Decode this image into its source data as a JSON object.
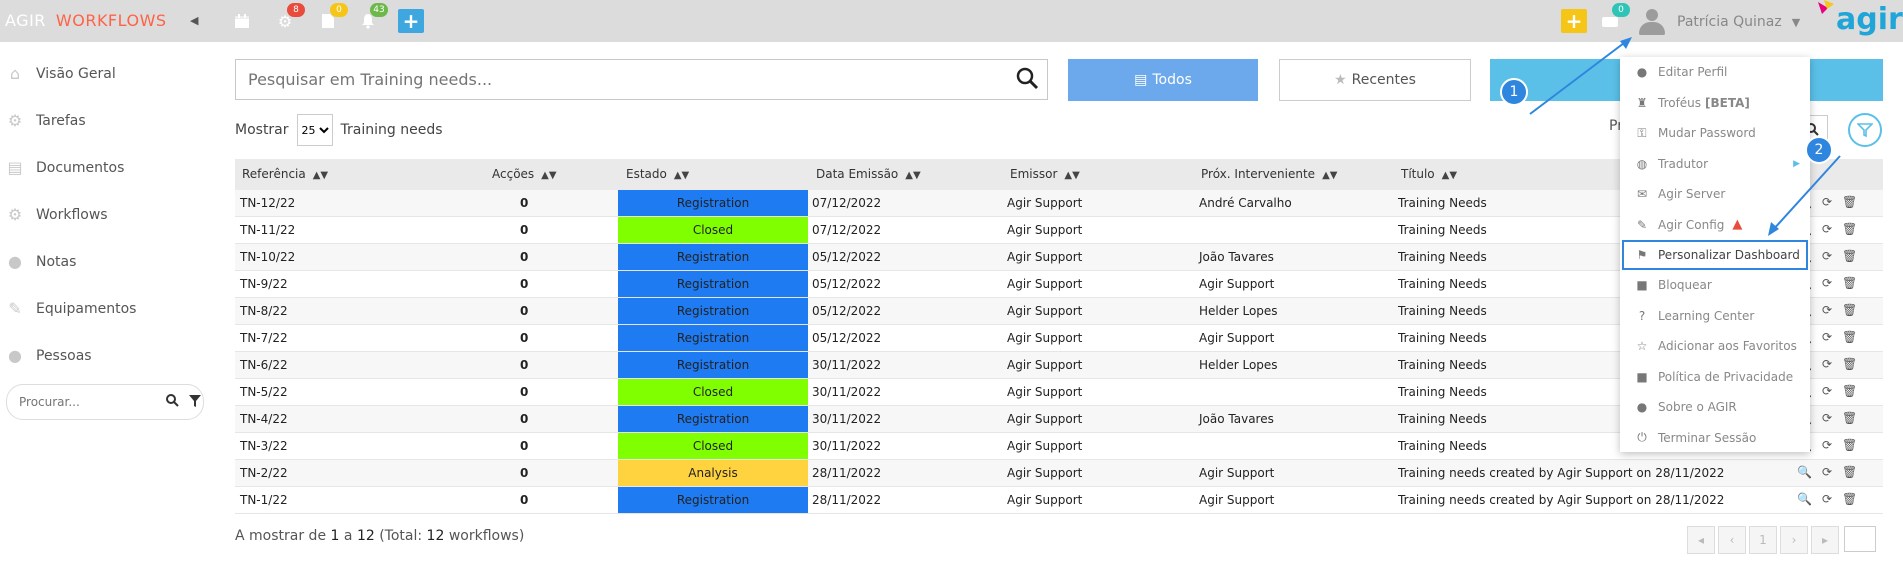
{
  "app": {
    "brand_a": "AGIR",
    "brand_b": "WORKFLOWS"
  },
  "topbar": {
    "badges": {
      "settings": "8",
      "documents": "0",
      "notifications": "43",
      "messages": "0"
    },
    "user_name": "Patrícia Quinaz",
    "logo_text": "agir"
  },
  "sidebar": {
    "items": [
      {
        "label": "Visão Geral",
        "icon": "home-icon"
      },
      {
        "label": "Tarefas",
        "icon": "gear-icon"
      },
      {
        "label": "Documentos",
        "icon": "document-icon"
      },
      {
        "label": "Workflows",
        "icon": "gears-icon"
      },
      {
        "label": "Notas",
        "icon": "chat-icon"
      },
      {
        "label": "Equipamentos",
        "icon": "wrench-icon"
      },
      {
        "label": "Pessoas",
        "icon": "user-icon"
      }
    ],
    "search_placeholder": "Procurar..."
  },
  "search": {
    "placeholder": "Pesquisar em Training needs..."
  },
  "filters": {
    "todos": "Todos",
    "recentes": "Recentes"
  },
  "show": {
    "prefix": "Mostrar",
    "value": "25",
    "suffix": "Training needs",
    "right_label": "Pr"
  },
  "table": {
    "headers": [
      "Referência",
      "Acções",
      "Estado",
      "Data Emissão",
      "Emissor",
      "Próx. Interveniente",
      "Título"
    ],
    "rows": [
      {
        "ref": "TN-12/22",
        "acc": "0",
        "state": "Registration",
        "date": "07/12/2022",
        "emissor": "Agir Support",
        "prox": "André Carvalho",
        "title": "Training Needs"
      },
      {
        "ref": "TN-11/22",
        "acc": "0",
        "state": "Closed",
        "date": "07/12/2022",
        "emissor": "Agir Support",
        "prox": "",
        "title": "Training Needs"
      },
      {
        "ref": "TN-10/22",
        "acc": "0",
        "state": "Registration",
        "date": "05/12/2022",
        "emissor": "Agir Support",
        "prox": "João Tavares",
        "title": "Training Needs"
      },
      {
        "ref": "TN-9/22",
        "acc": "0",
        "state": "Registration",
        "date": "05/12/2022",
        "emissor": "Agir Support",
        "prox": "Agir Support",
        "title": "Training Needs"
      },
      {
        "ref": "TN-8/22",
        "acc": "0",
        "state": "Registration",
        "date": "05/12/2022",
        "emissor": "Agir Support",
        "prox": "Helder Lopes",
        "title": "Training Needs"
      },
      {
        "ref": "TN-7/22",
        "acc": "0",
        "state": "Registration",
        "date": "05/12/2022",
        "emissor": "Agir Support",
        "prox": "Agir Support",
        "title": "Training Needs"
      },
      {
        "ref": "TN-6/22",
        "acc": "0",
        "state": "Registration",
        "date": "30/11/2022",
        "emissor": "Agir Support",
        "prox": "Helder Lopes",
        "title": "Training Needs"
      },
      {
        "ref": "TN-5/22",
        "acc": "0",
        "state": "Closed",
        "date": "30/11/2022",
        "emissor": "Agir Support",
        "prox": "",
        "title": "Training Needs"
      },
      {
        "ref": "TN-4/22",
        "acc": "0",
        "state": "Registration",
        "date": "30/11/2022",
        "emissor": "Agir Support",
        "prox": "João Tavares",
        "title": "Training Needs"
      },
      {
        "ref": "TN-3/22",
        "acc": "0",
        "state": "Closed",
        "date": "30/11/2022",
        "emissor": "Agir Support",
        "prox": "",
        "title": "Training Needs"
      },
      {
        "ref": "TN-2/22",
        "acc": "0",
        "state": "Analysis",
        "date": "28/11/2022",
        "emissor": "Agir Support",
        "prox": "Agir Support",
        "title": "Training needs created by Agir Support on 28/11/2022"
      },
      {
        "ref": "TN-1/22",
        "acc": "0",
        "state": "Registration",
        "date": "28/11/2022",
        "emissor": "Agir Support",
        "prox": "Agir Support",
        "title": "Training needs created by Agir Support on 28/11/2022"
      }
    ]
  },
  "state_colors": {
    "Registration": "#1e7bf2",
    "Closed": "#7fff00",
    "Analysis": "#ffd23f"
  },
  "footer": {
    "prefix": "A mostrar de",
    "from": "1",
    "mid": "a",
    "to": "12",
    "total_prefix": "(Total:",
    "total": "12",
    "total_suffix": "workflows)",
    "page": "1"
  },
  "menu": {
    "items": [
      {
        "label": "Editar Perfil",
        "icon": "user-icon"
      },
      {
        "label": "Troféus",
        "extra": "[BETA]",
        "icon": "trophy-icon"
      },
      {
        "label": "Mudar Password",
        "icon": "key-icon"
      },
      {
        "label": "Tradutor",
        "icon": "globe-icon"
      },
      {
        "label": "Agir Server",
        "icon": "envelope-icon"
      },
      {
        "label": "Agir Config",
        "icon": "wrench-icon"
      },
      {
        "label": "Personalizar Dashboard",
        "icon": "flag-icon"
      },
      {
        "label": "Bloquear",
        "icon": "lock-icon"
      },
      {
        "label": "Learning Center",
        "icon": "question-icon"
      },
      {
        "label": "Adicionar aos Favoritos",
        "icon": "star-icon"
      },
      {
        "label": "Política de Privacidade",
        "icon": "lock-icon"
      },
      {
        "label": "Sobre o AGIR",
        "icon": "info-icon"
      },
      {
        "label": "Terminar Sessão",
        "icon": "power-icon"
      }
    ]
  },
  "callouts": {
    "one": "1",
    "two": "2"
  },
  "colors": {
    "accent": "#2e86de",
    "brand_red": "#ff6347",
    "todos_bg": "#6ca8ec",
    "logo": "#1fa5d8"
  }
}
